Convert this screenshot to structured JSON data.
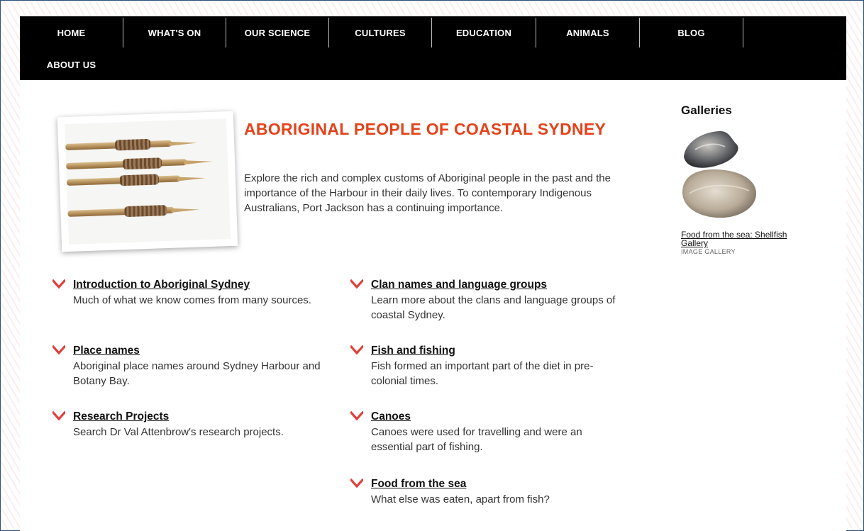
{
  "nav": {
    "items": [
      {
        "label": "HOME"
      },
      {
        "label": "WHAT'S ON"
      },
      {
        "label": "OUR SCIENCE"
      },
      {
        "label": "CULTURES"
      },
      {
        "label": "EDUCATION"
      },
      {
        "label": "ANIMALS"
      },
      {
        "label": "BLOG"
      },
      {
        "label": "ABOUT US"
      }
    ]
  },
  "hero": {
    "title": "ABORIGINAL PEOPLE OF COASTAL SYDNEY",
    "description": "Explore the rich and complex customs of Aboriginal people in the past and the importance of the Harbour in their daily lives. To contemporary Indigenous Australians, Port Jackson has a continuing importance."
  },
  "links": {
    "left": [
      {
        "title": "Introduction to Aboriginal Sydney",
        "desc": "Much of what we know comes from many sources."
      },
      {
        "title": "Place names",
        "desc": "Aboriginal place names around Sydney Harbour and Botany Bay."
      },
      {
        "title": "Research Projects",
        "desc": "Search Dr Val Attenbrow's research projects."
      }
    ],
    "right": [
      {
        "title": "Clan names and language groups",
        "desc": "Learn more about the clans and language groups of coastal Sydney."
      },
      {
        "title": "Fish and fishing",
        "desc": "Fish formed an important part of the diet in pre-colonial times."
      },
      {
        "title": "Canoes",
        "desc": "Canoes were used for travelling and were an essential part of fishing."
      },
      {
        "title": "Food from the sea",
        "desc": "What else was eaten, apart from fish?"
      }
    ]
  },
  "sidebar": {
    "heading": "Galleries",
    "gallery_link": "Food from the sea: Shellfish Gallery",
    "gallery_type": "IMAGE GALLERY"
  },
  "colors": {
    "accent": "#e4421a",
    "nav_bg": "#000000",
    "chevron": "#e0403a"
  }
}
